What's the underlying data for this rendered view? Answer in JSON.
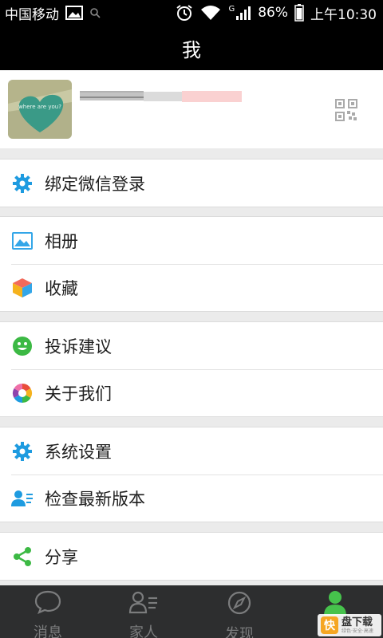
{
  "status_bar": {
    "carrier": "中国移动",
    "network": "G",
    "battery": "86%",
    "time": "上午10:30"
  },
  "header": {
    "title": "我"
  },
  "profile": {
    "avatar_text": "where are you?",
    "name": "",
    "qr_icon": "qr-code-icon"
  },
  "menu_groups": [
    {
      "items": [
        {
          "label": "绑定微信登录",
          "icon": "gear-icon",
          "color": "#1e9be0"
        }
      ]
    },
    {
      "items": [
        {
          "label": "相册",
          "icon": "album-icon",
          "color": "#33a6e8"
        },
        {
          "label": "收藏",
          "icon": "cube-icon",
          "color": "#f5b21d"
        }
      ]
    },
    {
      "items": [
        {
          "label": "投诉建议",
          "icon": "smiley-icon",
          "color": "#3cb944"
        },
        {
          "label": "关于我们",
          "icon": "aperture-icon",
          "color": "#e94d3a"
        }
      ]
    },
    {
      "items": [
        {
          "label": "系统设置",
          "icon": "gear-icon",
          "color": "#1e9be0"
        },
        {
          "label": "检查最新版本",
          "icon": "user-list-icon",
          "color": "#1e9be0"
        }
      ]
    },
    {
      "items": [
        {
          "label": "分享",
          "icon": "share-icon",
          "color": "#3cb944"
        }
      ]
    }
  ],
  "tab_bar": {
    "tabs": [
      {
        "label": "消息",
        "icon": "chat-bubble-icon"
      },
      {
        "label": "家人",
        "icon": "contacts-icon"
      },
      {
        "label": "发现",
        "icon": "compass-icon"
      },
      {
        "label": "",
        "icon": "person-icon",
        "active": true
      }
    ],
    "active_color": "#46c24c"
  },
  "watermark": {
    "logo": "快",
    "main": "盘下载",
    "sub": "绿色·安全·高速"
  }
}
